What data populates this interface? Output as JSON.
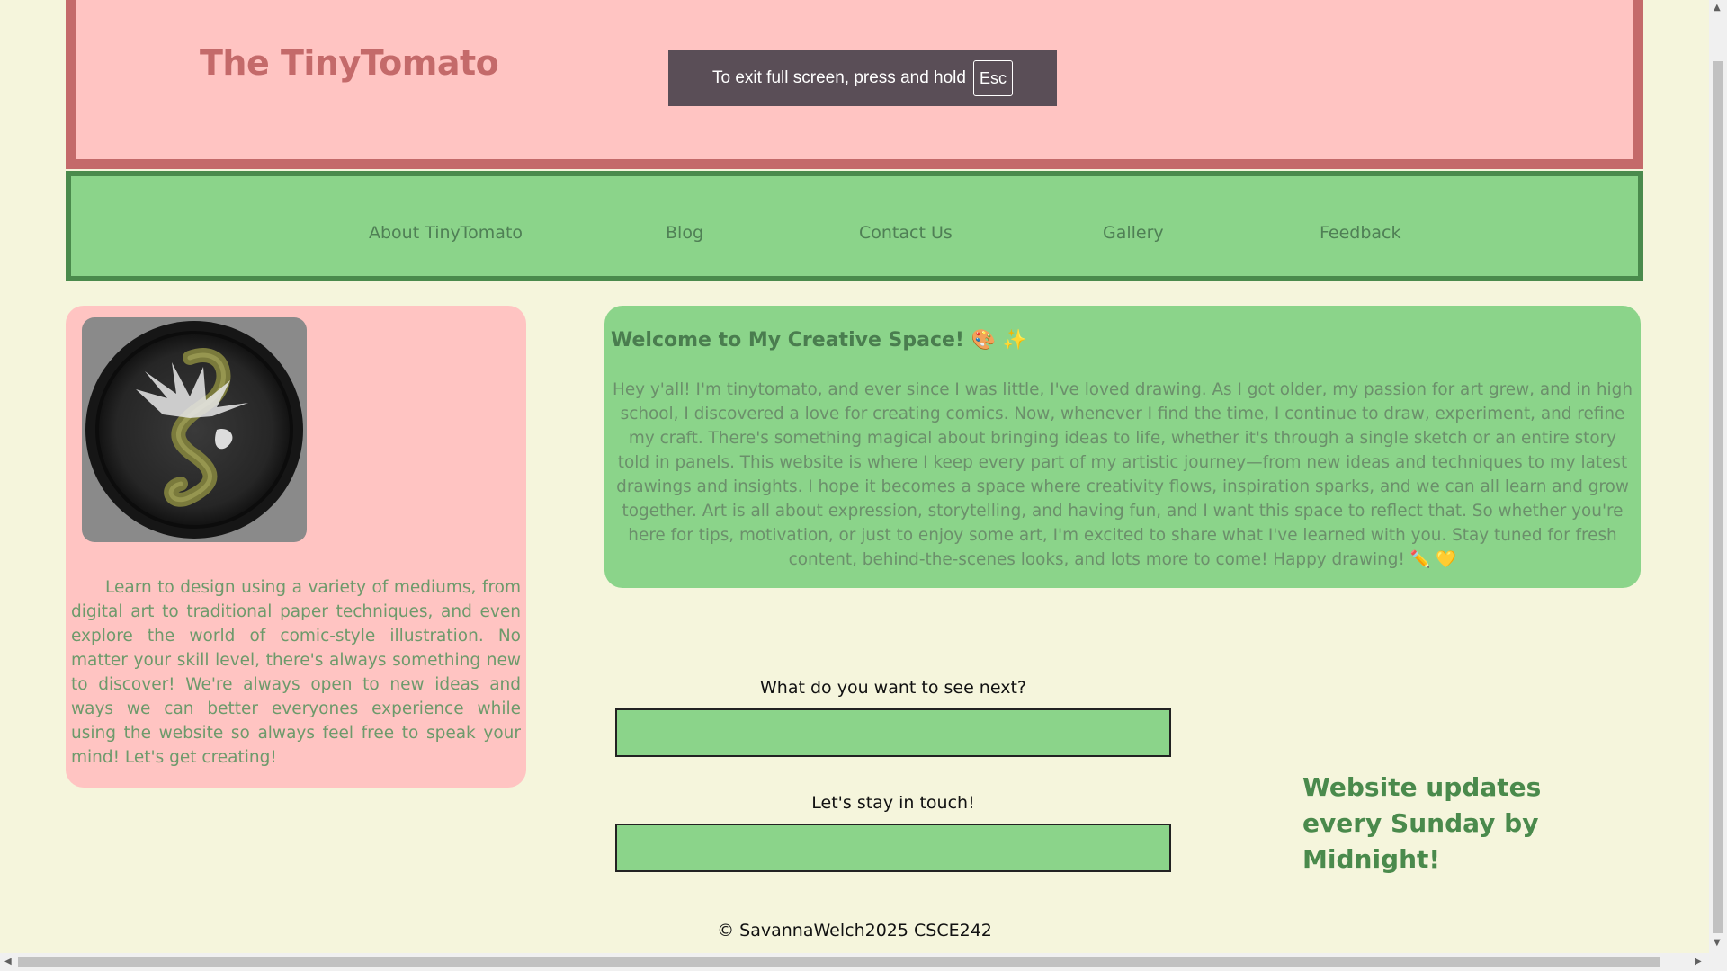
{
  "header": {
    "title": "The TinyTomato",
    "colors": {
      "background": "#ffc4c2",
      "border": "#c46a6a"
    }
  },
  "fullscreen_toast": {
    "message": "To exit full screen, press and hold",
    "key": "Esc"
  },
  "nav": {
    "items": [
      {
        "label": "About TinyTomato"
      },
      {
        "label": "Blog"
      },
      {
        "label": "Contact Us"
      },
      {
        "label": "Gallery"
      },
      {
        "label": "Feedback"
      }
    ],
    "colors": {
      "background": "#8bd48a",
      "border": "#4a8a4c"
    }
  },
  "left_card": {
    "image_icon": "serpent-logo-icon",
    "text": "Learn to design using a variety of mediums, from digital art to traditional paper techniques, and even explore the world of comic-style illustration. No matter your skill level, there's always something new to discover! We're always open to new ideas and ways we can better everyones experience while using the website so always feel free to speak your mind! Let's get creating!"
  },
  "welcome": {
    "title": "Welcome to My Creative Space! 🎨 ✨",
    "body": "Hey y'all! I'm tinytomato, and ever since I was little, I've loved drawing. As I got older, my passion for art grew, and in high school, I discovered a love for creating comics. Now, whenever I find the time, I continue to draw, experiment, and refine my craft. There's something magical about bringing ideas to life, whether it's through a single sketch or an entire story told in panels. This website is where I keep every part of my artistic journey—from new ideas and techniques to my latest drawings and insights. I hope it becomes a space where creativity flows, inspiration sparks, and we can all learn and grow together. Art is all about expression, storytelling, and having fun, and I want this space to reflect that. So whether you're here for tips, motivation, or just to enjoy some art, I'm excited to share what I've learned with you. Stay tuned for fresh content, behind-the-scenes looks, and lots more to come! Happy drawing! ✏️ 💛"
  },
  "form": {
    "next_label": "What do you want to see next?",
    "next_value": "",
    "contact_label": "Let's stay in touch!",
    "contact_value": ""
  },
  "updates_note": "Website updates every Sunday by Midnight!",
  "footer": {
    "text": "© SavannaWelch2025 CSCE242"
  },
  "theme": {
    "page_background": "#f5f5dc",
    "accent_green": "#8bd48a",
    "accent_pink": "#ffc4c2"
  }
}
